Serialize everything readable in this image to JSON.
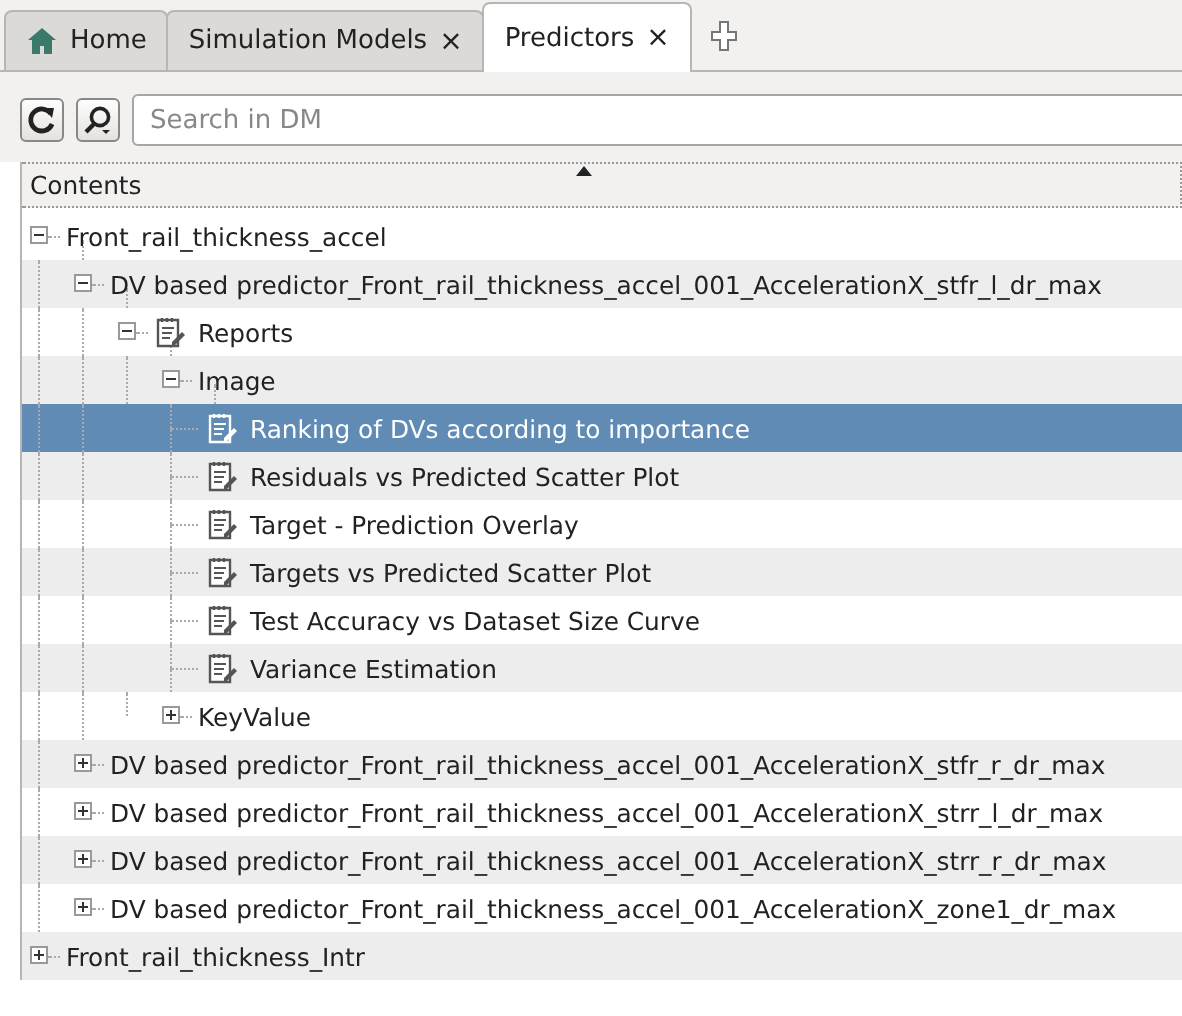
{
  "tabs": [
    {
      "label": "Home",
      "kind": "home",
      "closable": false,
      "selected": false
    },
    {
      "label": "Simulation Models",
      "kind": "plain",
      "closable": true,
      "selected": false
    },
    {
      "label": "Predictors",
      "kind": "plain",
      "closable": true,
      "selected": true
    }
  ],
  "tab_close_glyph": "×",
  "search": {
    "placeholder": "Search in DM"
  },
  "tree": {
    "header": "Contents",
    "items": [
      {
        "label": "Front_rail_thickness_accel",
        "kind": "folder",
        "expanded": true,
        "selected": false,
        "children": [
          {
            "label": "DV based predictor_Front_rail_thickness_accel_001_AccelerationX_stfr_l_dr_max",
            "kind": "folder",
            "expanded": true,
            "selected": false,
            "children": [
              {
                "label": "Reports",
                "kind": "report-folder",
                "expanded": true,
                "selected": false,
                "children": [
                  {
                    "label": "Image",
                    "kind": "folder",
                    "expanded": true,
                    "selected": false,
                    "children": [
                      {
                        "label": "Ranking of DVs according to importance",
                        "kind": "report",
                        "selected": true
                      },
                      {
                        "label": "Residuals vs Predicted Scatter Plot",
                        "kind": "report",
                        "selected": false
                      },
                      {
                        "label": "Target - Prediction Overlay",
                        "kind": "report",
                        "selected": false
                      },
                      {
                        "label": "Targets vs Predicted Scatter Plot",
                        "kind": "report",
                        "selected": false
                      },
                      {
                        "label": "Test Accuracy vs Dataset Size Curve",
                        "kind": "report",
                        "selected": false
                      },
                      {
                        "label": "Variance Estimation",
                        "kind": "report",
                        "selected": false
                      }
                    ]
                  },
                  {
                    "label": "KeyValue",
                    "kind": "folder",
                    "expanded": false,
                    "selected": false
                  }
                ]
              }
            ]
          },
          {
            "label": "DV based predictor_Front_rail_thickness_accel_001_AccelerationX_stfr_r_dr_max",
            "kind": "folder",
            "expanded": false,
            "selected": false
          },
          {
            "label": "DV based predictor_Front_rail_thickness_accel_001_AccelerationX_strr_l_dr_max",
            "kind": "folder",
            "expanded": false,
            "selected": false
          },
          {
            "label": "DV based predictor_Front_rail_thickness_accel_001_AccelerationX_strr_r_dr_max",
            "kind": "folder",
            "expanded": false,
            "selected": false
          },
          {
            "label": "DV based predictor_Front_rail_thickness_accel_001_AccelerationX_zone1_dr_max",
            "kind": "folder",
            "expanded": false,
            "selected": false
          }
        ]
      },
      {
        "label": "Front_rail_thickness_Intr",
        "kind": "folder",
        "expanded": false,
        "selected": false
      }
    ]
  }
}
